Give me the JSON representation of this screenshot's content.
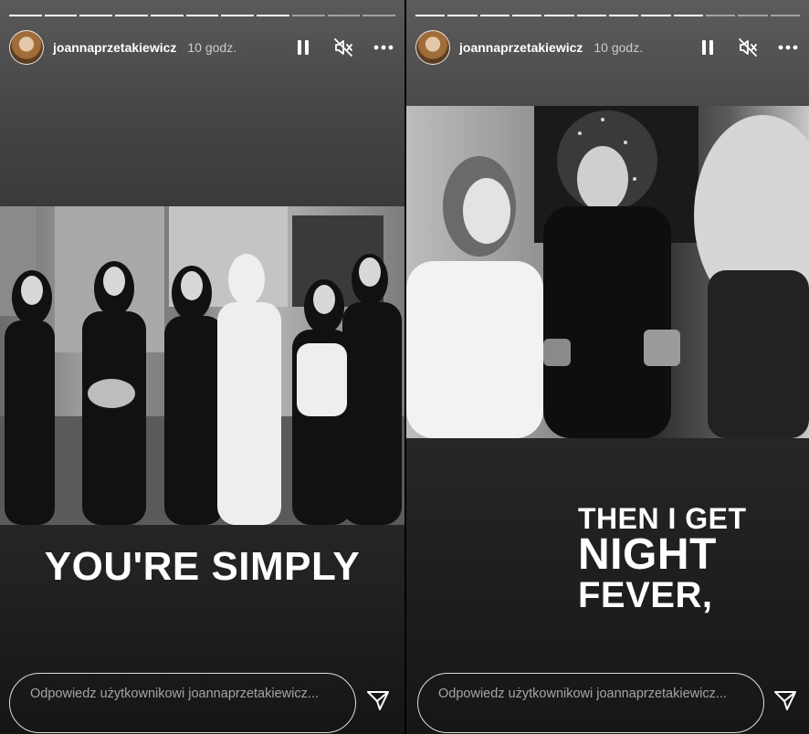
{
  "stories": [
    {
      "username": "joannaprzetakiewicz",
      "time": "10 godz.",
      "caption": "YOU'RE SIMPLY",
      "reply_placeholder": "Odpowiedz użytkownikowi joannaprzetakiewicz...",
      "progress": {
        "total_segments": 11,
        "completed_segments": 8
      }
    },
    {
      "username": "joannaprzetakiewicz",
      "time": "10 godz.",
      "caption_lines": [
        "THEN I GET",
        "NIGHT",
        "FEVER,"
      ],
      "reply_placeholder": "Odpowiedz użytkownikowi joannaprzetakiewicz...",
      "progress": {
        "total_segments": 12,
        "completed_segments": 9
      }
    }
  ],
  "icons": {
    "pause": "pause-icon",
    "mute": "speaker-muted-icon",
    "more": "more-options-icon",
    "send": "send-icon"
  },
  "colors": {
    "text": "#ffffff",
    "background": "#000000"
  }
}
